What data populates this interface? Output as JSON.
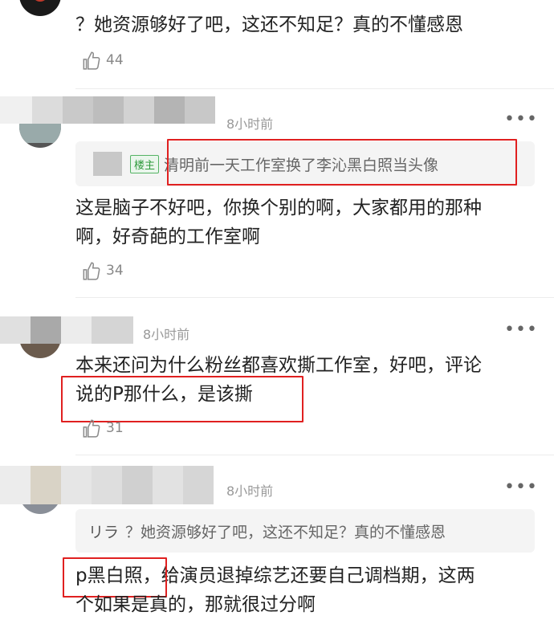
{
  "comments": [
    {
      "text": "？她资源够好了吧，这还不知足？真的不懂感恩",
      "likes": "44"
    },
    {
      "time": "8小时前",
      "more": "•••",
      "quote_badge": "楼主",
      "quote_text": "清明前一天工作室换了李沁黑白照当头像",
      "text_line1": "这是脑子不好吧，你换个别的啊，大家都用的那种",
      "text_line2": "啊，好奇葩的工作室啊",
      "likes": "34"
    },
    {
      "time": "8小时前",
      "more": "•••",
      "text_line1": "本来还问为什么粉丝都喜欢撕工作室，好吧，评论",
      "text_line2": "说的P那什么，是该撕",
      "likes": "31"
    },
    {
      "time": "8小时前",
      "more": "•••",
      "quote_user": "リラ",
      "quote_text": "？她资源够好了吧，这还不知足？真的不懂感恩",
      "text_highlight": "p黑白照，",
      "text_rest": "给演员退掉综艺还要自己调档期，这两",
      "text_line2": "个如果是真的，那就很过分啊"
    }
  ]
}
